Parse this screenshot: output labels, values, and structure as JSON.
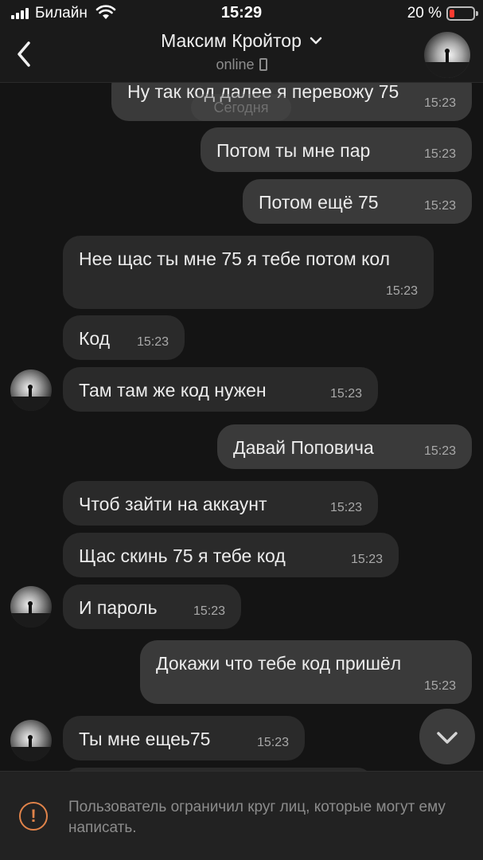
{
  "status_bar": {
    "carrier": "Билайн",
    "time": "15:29",
    "battery": "20 %",
    "battery_level": 0.2,
    "battery_color": "#ff3b30"
  },
  "header": {
    "back_icon": "chevron-left-icon",
    "contact_name": "Максим Кройтор",
    "status": "online",
    "status_icon": "phone-icon"
  },
  "chat": {
    "date_divider": "Сегодня",
    "messages": [
      {
        "dir": "out",
        "text": "Ну так код далее я перевожу 75",
        "time": "15:23"
      },
      {
        "dir": "out",
        "text": "Потом ты мне пар",
        "time": "15:23"
      },
      {
        "dir": "out",
        "text": "Потом ещё 75",
        "time": "15:23"
      },
      {
        "dir": "in",
        "text": "Нее щас ты мне 75 я тебе потом кол",
        "time": "15:23"
      },
      {
        "dir": "in",
        "text": "Код",
        "time": "15:23"
      },
      {
        "dir": "in",
        "text": "Там там же код нужен",
        "time": "15:23"
      },
      {
        "dir": "out",
        "text": "Давай Поповича",
        "time": "15:23"
      },
      {
        "dir": "in",
        "text": "Чтоб зайти на аккаунт",
        "time": "15:23"
      },
      {
        "dir": "in",
        "text": "Щас скинь 75 я тебе код",
        "time": "15:23"
      },
      {
        "dir": "in",
        "text": "И пароль",
        "time": "15:23"
      },
      {
        "dir": "out",
        "text": "Докажи что тебе код пришёл",
        "time": "15:23"
      },
      {
        "dir": "in",
        "text": "Ты мне ещеь75",
        "time": "15:23"
      }
    ]
  },
  "footer": {
    "warning_icon": "exclamation-circle-icon",
    "notice": "Пользователь ограничил круг лиц, которые могут ему написать.",
    "accent_color": "#e0834a"
  }
}
